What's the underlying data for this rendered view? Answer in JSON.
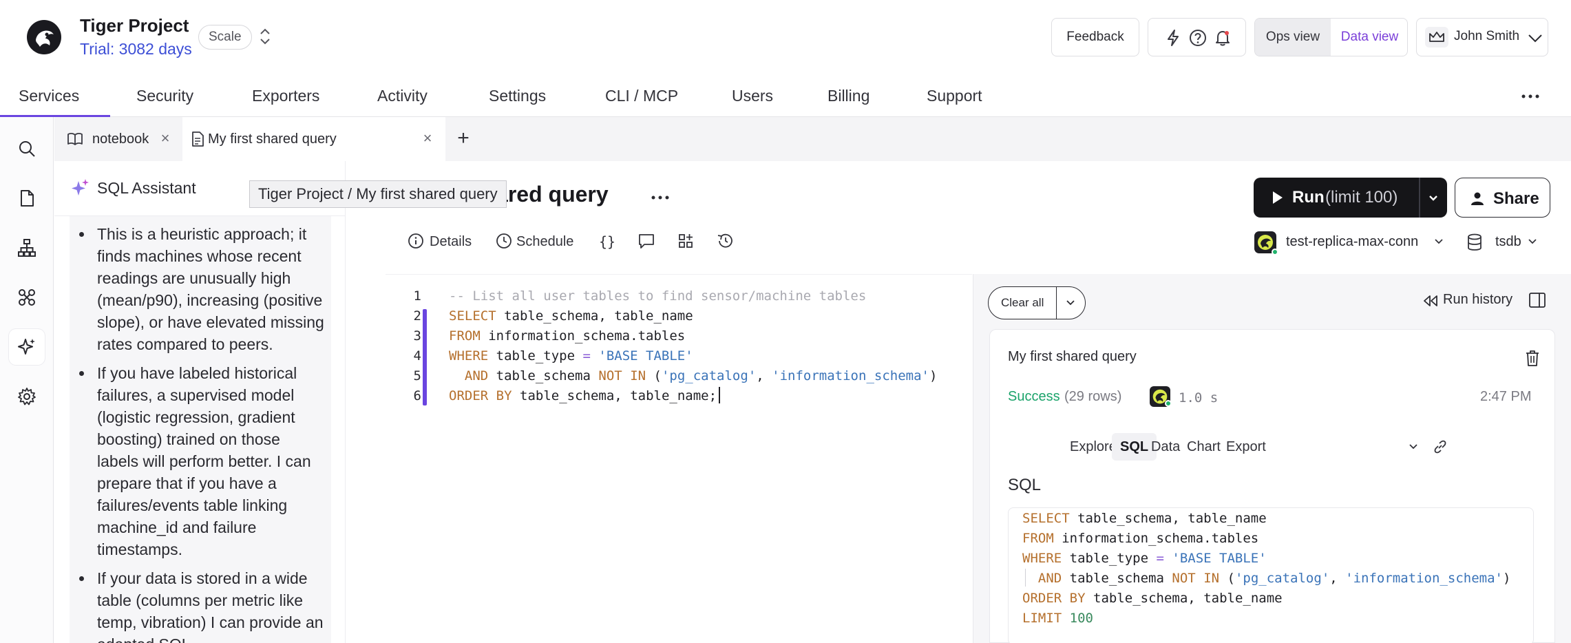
{
  "header": {
    "project_name": "Tiger Project",
    "trial": "Trial: 3082 days",
    "tier": "Scale",
    "feedback": "Feedback",
    "icons": [
      "lightning-icon",
      "help-icon",
      "bell-icon"
    ],
    "ops_view": "Ops view",
    "data_view": "Data view",
    "user_name": "John Smith"
  },
  "nav": {
    "tabs": [
      {
        "label": "Services",
        "active": true
      },
      {
        "label": "Security"
      },
      {
        "label": "Exporters"
      },
      {
        "label": "Activity"
      },
      {
        "label": "Settings"
      },
      {
        "label": "CLI / MCP"
      },
      {
        "label": "Users"
      },
      {
        "label": "Billing"
      },
      {
        "label": "Support"
      }
    ]
  },
  "rail": {
    "items": [
      "search-icon",
      "file-icon",
      "org-tree-icon",
      "integrations-icon",
      "sparkle-icon",
      "gear-icon"
    ],
    "active": "sparkle-icon"
  },
  "doc_tabs": [
    {
      "label": "notebook",
      "icon": "book-icon"
    },
    {
      "label": "My first shared query",
      "icon": "document-icon",
      "active": true
    }
  ],
  "assistant": {
    "title": "SQL Assistant",
    "bullets": [
      "This is a heuristic approach; it finds machines whose recent readings are unusually high (mean/p90), increasing (positive slope), or have elevated missing rates compared to peers.",
      "If you have labeled historical failures, a supervised model (logistic regression, gradient boosting) trained on those labels will perform better. I can prepare that if you have a failures/events table linking machine_id and failure timestamps.",
      "If your data is stored in a wide table (columns per metric like temp, vibration) I can provide an adapted SQL."
    ]
  },
  "query": {
    "title": "My first shared query",
    "title_visible_fragment": "red query",
    "tooltip": "Tiger Project / My first shared query",
    "run_label": "Run",
    "run_limit": "(limit 100)",
    "share_label": "Share",
    "toolbar": {
      "details": "Details",
      "schedule": "Schedule",
      "braces": "{}"
    },
    "connection": "test-replica-max-conn",
    "database": "tsdb"
  },
  "editor": {
    "line_numbers": [
      "1",
      "2",
      "3",
      "4",
      "5",
      "6"
    ],
    "lines": [
      "-- List all user tables to find sensor/machine tables",
      "SELECT table_schema, table_name",
      "FROM information_schema.tables",
      "WHERE table_type = 'BASE TABLE'",
      "  AND table_schema NOT IN ('pg_catalog', 'information_schema')",
      "ORDER BY table_schema, table_name;"
    ]
  },
  "results": {
    "clear_all": "Clear all",
    "run_history": "Run history",
    "card_title": "My first shared query",
    "status": "Success",
    "rows": "(29 rows)",
    "duration": "1.0 s",
    "time": "2:47 PM",
    "tabs": [
      "Explore",
      "SQL",
      "Data",
      "Chart",
      "Export"
    ],
    "active_tab": "SQL",
    "sql_heading": "SQL",
    "sql_lines": [
      "SELECT table_schema, table_name",
      "FROM information_schema.tables",
      "WHERE table_type = 'BASE TABLE'",
      "  AND table_schema NOT IN ('pg_catalog', 'information_schema')",
      "ORDER BY table_schema, table_name",
      "LIMIT 100"
    ]
  },
  "colors": {
    "accent": "#6a45e0",
    "link": "#3d4fd6",
    "data_view": "#7b3fd9",
    "success": "#1aa36a",
    "sql_keyword": "#b5702d",
    "sql_string": "#3a73b8"
  }
}
